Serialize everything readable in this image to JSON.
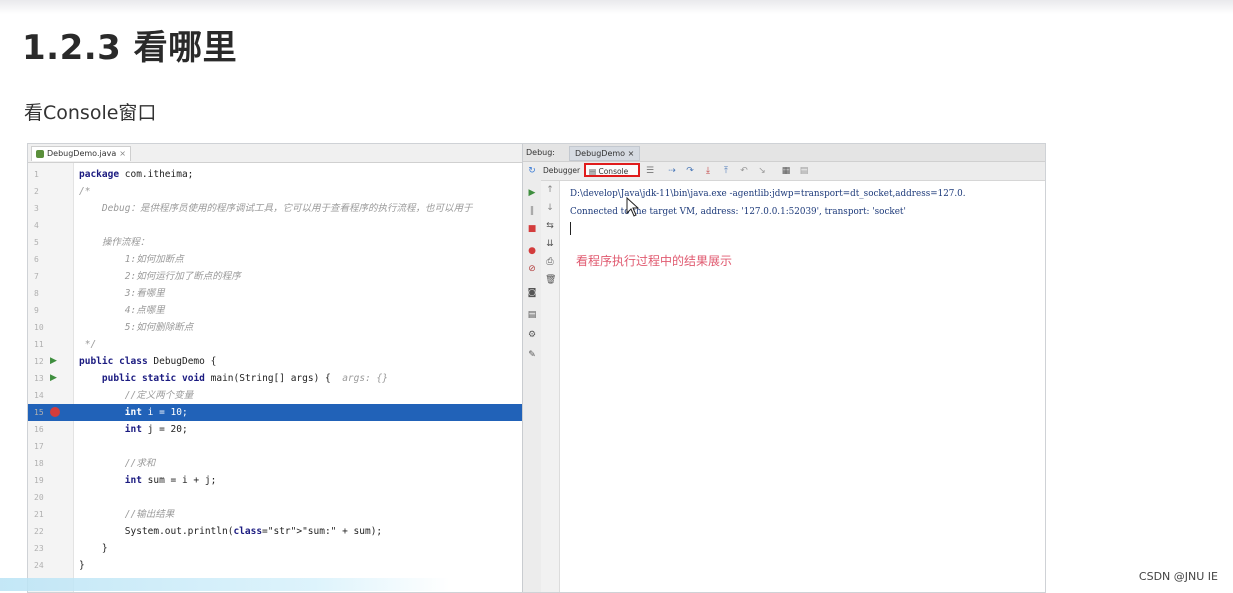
{
  "heading": "1.2.3 看哪里",
  "subheading": "看Console窗口",
  "watermark": "CSDN @JNU IE",
  "editor": {
    "tab_label": "DebugDemo.java",
    "tab_close": "×",
    "lines": [
      {
        "n": "1",
        "text": "package com.itheima;",
        "style": "pkg",
        "marker": ""
      },
      {
        "n": "2",
        "text": "/*",
        "style": "cm",
        "marker": ""
      },
      {
        "n": "3",
        "text": "    Debug：是供程序员使用的程序调试工具，它可以用于查看程序的执行流程，也可以用于",
        "style": "cm",
        "marker": ""
      },
      {
        "n": "4",
        "text": "",
        "style": "",
        "marker": ""
      },
      {
        "n": "5",
        "text": "    操作流程：",
        "style": "cm",
        "marker": ""
      },
      {
        "n": "6",
        "text": "        1:如何加断点",
        "style": "cm",
        "marker": ""
      },
      {
        "n": "7",
        "text": "        2:如何运行加了断点的程序",
        "style": "cm",
        "marker": ""
      },
      {
        "n": "8",
        "text": "        3:看哪里",
        "style": "cm",
        "marker": ""
      },
      {
        "n": "9",
        "text": "        4:点哪里",
        "style": "cm",
        "marker": ""
      },
      {
        "n": "10",
        "text": "        5:如何删除断点",
        "style": "cm",
        "marker": ""
      },
      {
        "n": "11",
        "text": " */",
        "style": "cm",
        "marker": ""
      },
      {
        "n": "12",
        "text": "public class DebugDemo {",
        "style": "cls",
        "marker": "run"
      },
      {
        "n": "13",
        "text": "    public static void main(String[] args) {  args: {}",
        "style": "main",
        "marker": "run"
      },
      {
        "n": "14",
        "text": "        //定义两个变量",
        "style": "cm",
        "marker": ""
      },
      {
        "n": "15",
        "text": "        int i = 10;",
        "style": "hl",
        "marker": "bp"
      },
      {
        "n": "16",
        "text": "        int j = 20;",
        "style": "int",
        "marker": ""
      },
      {
        "n": "17",
        "text": "",
        "style": "",
        "marker": ""
      },
      {
        "n": "18",
        "text": "        //求和",
        "style": "cm",
        "marker": ""
      },
      {
        "n": "19",
        "text": "        int sum = i + j;",
        "style": "int",
        "marker": ""
      },
      {
        "n": "20",
        "text": "",
        "style": "",
        "marker": ""
      },
      {
        "n": "21",
        "text": "        //输出结果",
        "style": "cm",
        "marker": ""
      },
      {
        "n": "22",
        "text": "        System.out.println(\"sum:\" + sum);",
        "style": "print",
        "marker": ""
      },
      {
        "n": "23",
        "text": "    }",
        "style": "",
        "marker": ""
      },
      {
        "n": "24",
        "text": "}",
        "style": "",
        "marker": ""
      }
    ]
  },
  "debug_panel": {
    "label": "Debug:",
    "run_tab": "DebugDemo",
    "run_tab_close": "×",
    "debugger_tab": "Debugger",
    "console_tab": "Console",
    "console_lines": [
      "D:\\develop\\Java\\jdk-11\\bin\\java.exe -agentlib:jdwp=transport=dt_socket,address=127.0.",
      "Connected to the target VM, address: '127.0.0.1:52039', transport: 'socket'"
    ],
    "annotation": "看程序执行过程中的结果展示"
  },
  "colors": {
    "highlight": "#2162b8",
    "console_outline": "#e01b1b",
    "annotation": "#e05a70",
    "breakpoint": "#d33c3c"
  }
}
